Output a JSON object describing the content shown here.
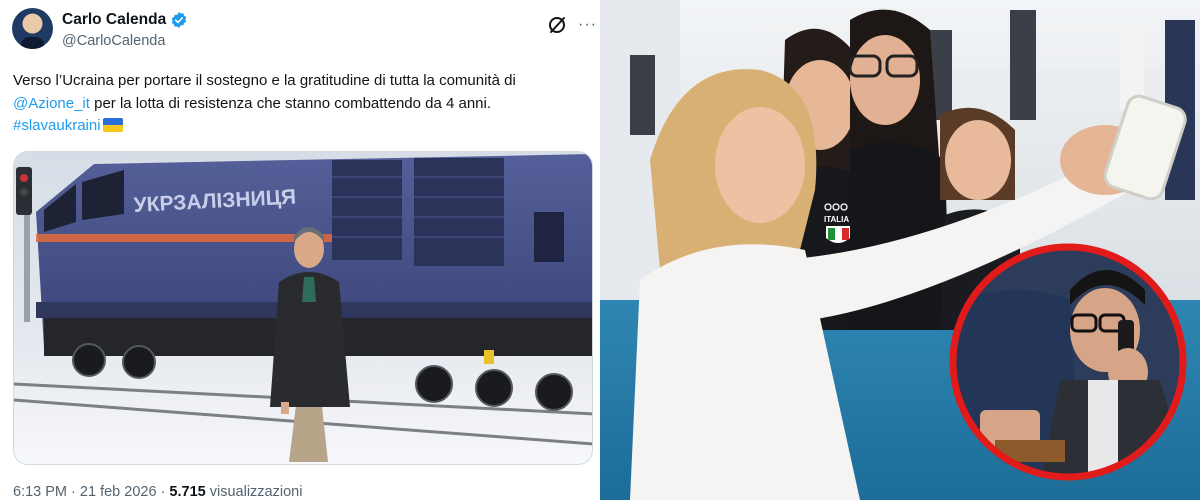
{
  "tweet": {
    "author_name": "Carlo Calenda",
    "author_handle": "@CarloCalenda",
    "text_part1": "Verso l’Ucraina per portare il sostegno e la gratitudine di tutta la comunità di ",
    "mention": "@Azione_it",
    "text_part2": " per la lotta di resistenza che stanno combattendo da 4 anni.",
    "hashtag": "#slavaukraini",
    "time": "6:13 PM",
    "date": "21 feb 2026",
    "views_count": "5.715",
    "views_label": "visualizzazioni",
    "separator": "·"
  },
  "train": {
    "livery_text": "УКРЗАЛІЗНИЦЯ"
  },
  "photo": {
    "jersey_text": "ITALIA"
  },
  "colors": {
    "link": "#1d9bf0",
    "verified": "#1d9bf0",
    "train_body": "#454f86",
    "highlight_circle": "#e11a1a",
    "flag_blue": "#2a6cd9",
    "flag_yellow": "#f7c71a"
  },
  "icons": {
    "verified": "verified-badge-icon",
    "grok": "grok-icon",
    "more": "more-icon",
    "flag": "ukraine-flag-icon"
  }
}
